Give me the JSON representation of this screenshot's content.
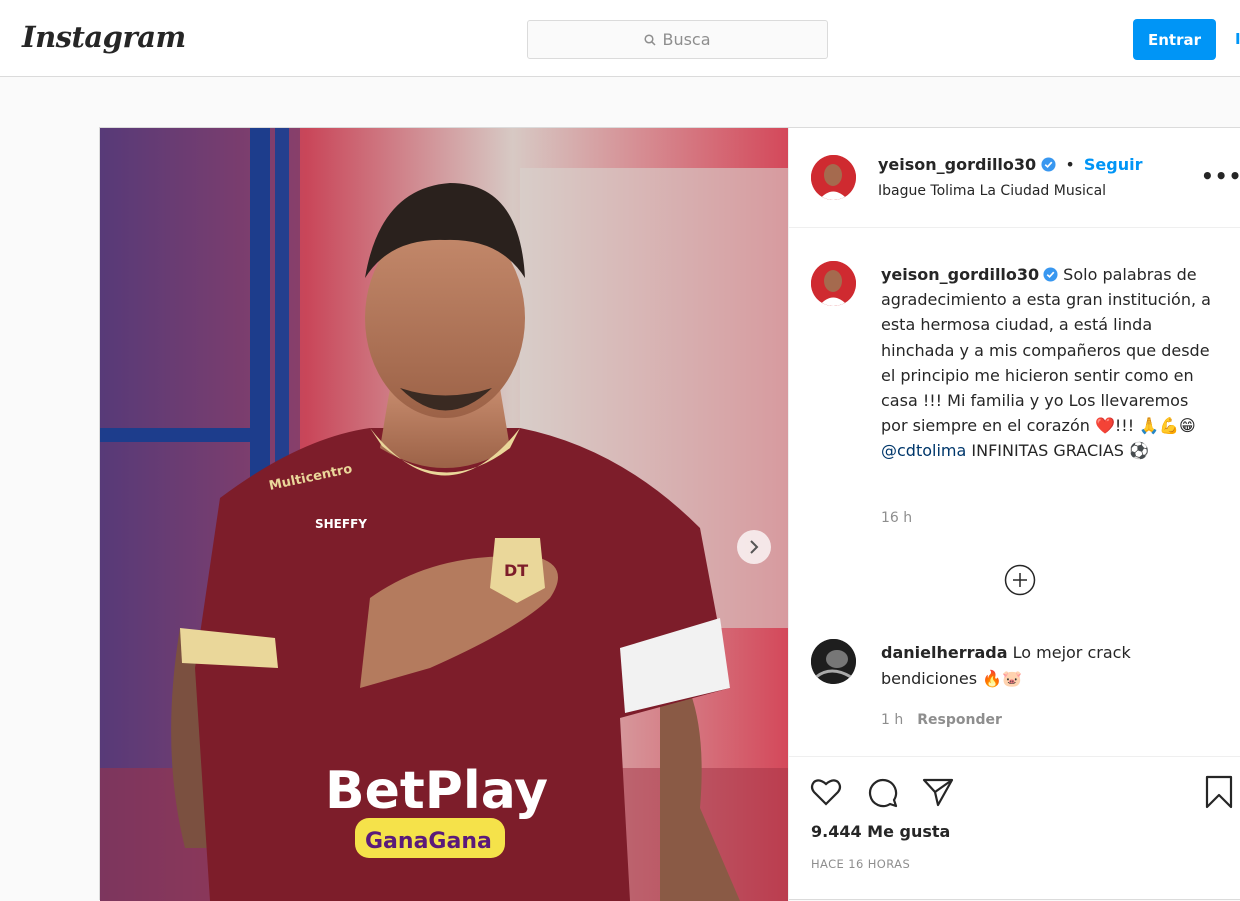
{
  "header": {
    "logo": "Instagram",
    "search_placeholder": "Busca",
    "login_label": "Entrar"
  },
  "post": {
    "author": "yeison_gordillo30",
    "follow_label": "Seguir",
    "location": "Ibague Tolima La Ciudad Musical",
    "caption_text": "Solo palabras de agradecimiento a esta gran institución, a esta hermosa ciudad, a está linda hinchada y a mis compañeros que desde el principio me hicieron sentir como en casa !!! Mi familia y yo Los llevaremos por siempre en el corazón ❤️!!! 🙏💪😁",
    "caption_mention": "@cdtolima",
    "caption_end": "INFINITAS GRACIAS ⚽",
    "caption_time": "16 h",
    "likes": "9.444 Me gusta",
    "posted_ago": "HACE 16 HORAS"
  },
  "comments": [
    {
      "author": "danielherrada",
      "text": "Lo mejor crack bendiciones 🔥🐷",
      "time": "1 h",
      "reply_label": "Responder"
    }
  ],
  "photo": {
    "jersey_sponsor": "BetPlay",
    "jersey_sponsor2": "GanaGana",
    "jersey_brand": "Multicentro",
    "jersey_maker": "SHEFFY",
    "club_badge": "DT"
  },
  "colors": {
    "accent": "#0095f6",
    "jersey": "#7d1d2a",
    "trim": "#ead79a",
    "background": "#fafafa"
  },
  "icons": [
    "search-icon",
    "verified-icon",
    "more-icon",
    "next-arrow-icon",
    "add-comment-icon",
    "heart-icon",
    "comment-icon",
    "share-icon",
    "bookmark-icon"
  ]
}
